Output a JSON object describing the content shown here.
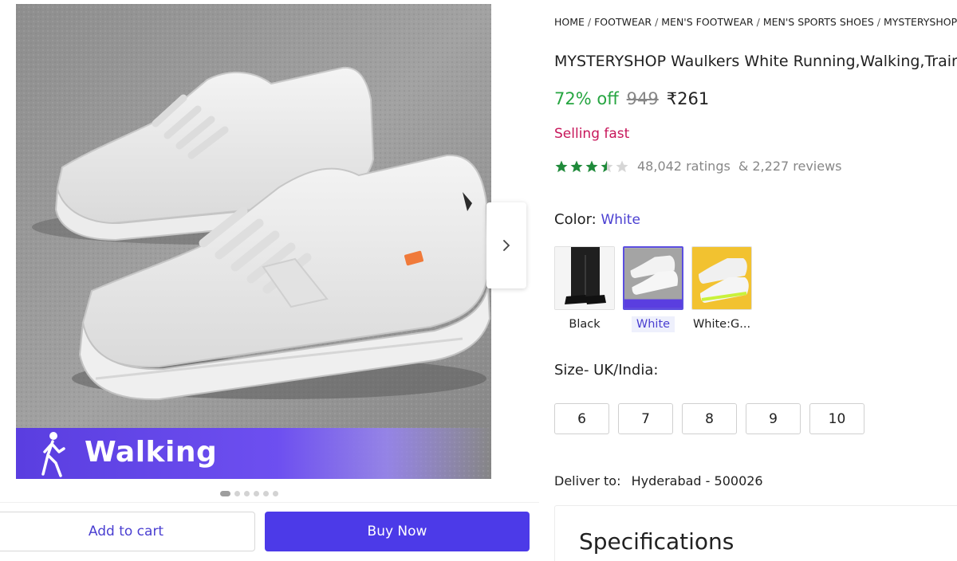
{
  "gallery": {
    "banner_text": "Walking",
    "dots_total": 6,
    "dots_active": 1
  },
  "actions": {
    "add_to_cart": "Add to cart",
    "buy_now": "Buy Now"
  },
  "breadcrumb": [
    "HOME",
    "FOOTWEAR",
    "MEN'S FOOTWEAR",
    "MEN'S SPORTS SHOES",
    "MYSTERYSHOP MEN'S"
  ],
  "product": {
    "title": "MYSTERYSHOP Waulkers White Running,Walking,Training Shoes",
    "discount": "72% off",
    "mrp": "949",
    "price": "₹261",
    "urgency": "Selling fast",
    "rating_value": 3.5,
    "ratings_text": "48,042 ratings",
    "reviews_text": "& 2,227 reviews"
  },
  "color": {
    "label": "Color:",
    "selected": "White",
    "options": [
      {
        "name": "Black",
        "selected": false
      },
      {
        "name": "White",
        "selected": true
      },
      {
        "name": "White:G...",
        "selected": false
      }
    ]
  },
  "size": {
    "label": "Size- UK/India:",
    "options": [
      "6",
      "7",
      "8",
      "9",
      "10"
    ]
  },
  "delivery": {
    "label": "Deliver to:",
    "location": "Hyderabad - 500026"
  },
  "specs": {
    "title": "Specifications"
  },
  "colors": {
    "accent": "#4c3ae8",
    "discount_green": "#26a541",
    "urgency_pink": "#c7165a",
    "star_green": "#1f8a3a"
  }
}
